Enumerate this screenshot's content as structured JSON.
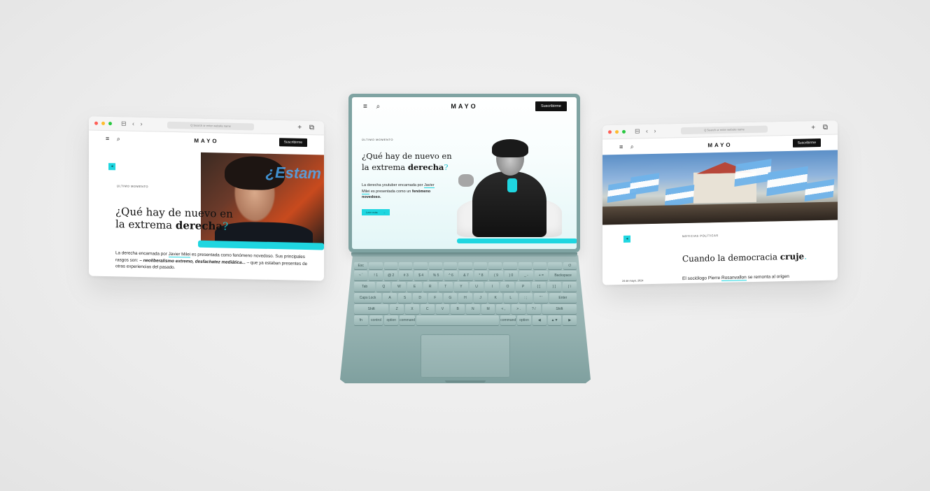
{
  "site": {
    "logo": "MAYO",
    "subscribe_label": "Suscribirme",
    "menu_icon": "hamburger-icon",
    "search_icon": "search-icon",
    "accent_color": "#1fd6e0"
  },
  "browser_left": {
    "url_placeholder": "Q  Search or enter website name",
    "nav_glyphs": "⊟ ‹ ›",
    "tool_glyphs": "+ ⧉",
    "kicker": "ÚLTIMO MOMENTO",
    "headline_start": "¿Qué hay de nuevo en la extrema ",
    "headline_bold": "derecha",
    "headline_end": "?",
    "body_1": "La derecha encarnada por ",
    "body_name": "Javier Milei",
    "body_2": " es presentada como fenómeno novedoso. Sus principales rasgos son: ",
    "body_em": "– neoliberalismo extremo, desfachatez mediática...",
    "body_3": " – que ya estaban presentes de otras experiencias del pasado.",
    "photo_sign": "¿Estam"
  },
  "laptop": {
    "kicker": "ÚLTIMO MOMENTO",
    "headline_start": "¿Qué hay de nuevo en la extrema ",
    "headline_bold": "derecha",
    "headline_end": "?",
    "body_1": "La derecha youtuber encarnada por ",
    "body_name": "Javier Milei",
    "body_2": " es presentada como un ",
    "body_bold": "fenómeno novedoso.",
    "button_label": "Leer más",
    "button_arrow": "→"
  },
  "browser_right": {
    "url_placeholder": "Q  Search or enter website name",
    "nav_glyphs": "⊟ ‹ ›",
    "tool_glyphs": "+ ⧉",
    "kicker": "NOTICIAS POLÍTICAS",
    "headline_start": "Cuando la democracia ",
    "headline_bold": "cruje",
    "headline_end": ".",
    "date": "24 de mayo, 2024",
    "body_1": "El sociólogo Pierre ",
    "body_name": "Rosanvallon",
    "body_2": " se remonta al origen"
  },
  "keyboard": {
    "row_fn": [
      "Esc",
      "",
      "",
      "",
      "",
      "",
      "",
      "",
      "",
      "",
      "",
      "",
      "",
      "",
      "⏻"
    ],
    "row_1": [
      "~ `",
      "! 1",
      "@ 2",
      "# 3",
      "$ 4",
      "% 5",
      "^ 6",
      "& 7",
      "* 8",
      "( 9",
      ") 0",
      "_ -",
      "+ =",
      "Backspace"
    ],
    "row_2": [
      "Tab",
      "Q",
      "W",
      "E",
      "R",
      "T",
      "Y",
      "U",
      "I",
      "O",
      "P",
      "{ [",
      "} ]",
      "| \\"
    ],
    "row_3": [
      "Caps Lock",
      "A",
      "S",
      "D",
      "F",
      "G",
      "H",
      "J",
      "K",
      "L",
      ": ;",
      "\" '",
      "Enter"
    ],
    "row_4": [
      "Shift",
      "Z",
      "X",
      "C",
      "V",
      "B",
      "N",
      "M",
      "< ,",
      "> .",
      "? /",
      "Shift"
    ],
    "row_5": [
      "fn",
      "control",
      "option",
      "command",
      "",
      "command",
      "option",
      "◀",
      "▲▼",
      "▶"
    ]
  }
}
